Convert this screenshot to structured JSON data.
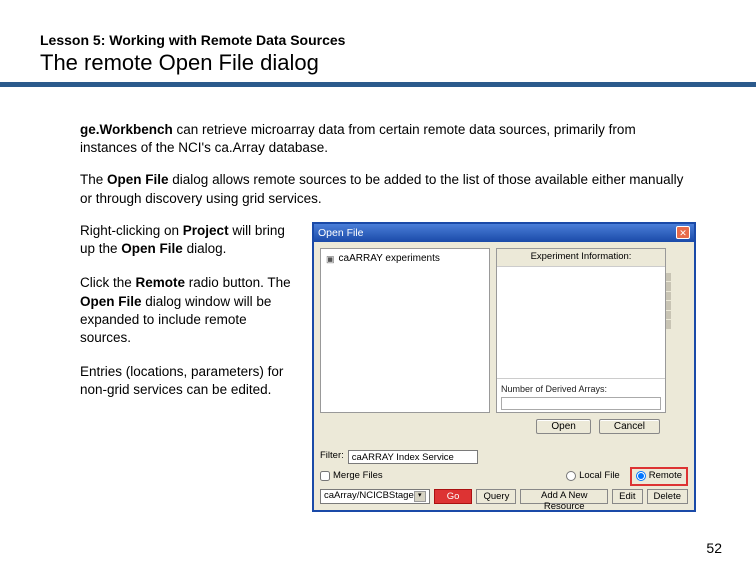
{
  "lesson_label": "Lesson 5: Working with Remote Data Sources",
  "slide_title": "The remote Open File dialog",
  "intro": {
    "brand": "ge.Workbench",
    "p1_rest": " can retrieve microarray data from certain remote data sources, primarily from instances of the NCI's ca.Array database.",
    "p2_a": "The ",
    "p2_bold": "Open File",
    "p2_b": " dialog allows remote sources to be added to the list of those available either manually or through discovery using grid services."
  },
  "left_text": {
    "p1_a": "Right-clicking on ",
    "p1_bold": "Project",
    "p1_b": " will bring up the ",
    "p1_bold2": "Open File",
    "p1_c": " dialog.",
    "p2_a": " Click the ",
    "p2_bold": "Remote",
    "p2_b": " radio button. The ",
    "p2_bold2": "Open File",
    "p2_c": " dialog window will be expanded to include remote sources.",
    "p3": "Entries (locations, parameters) for non-grid services can be edited."
  },
  "dialog": {
    "title": "Open File",
    "tree_item": "caARRAY experiments",
    "right_header": "Experiment Information:",
    "section2_label": "Number of Derived Arrays:",
    "open_btn": "Open",
    "cancel_btn": "Cancel",
    "filter_label": "Filter:",
    "filter_value": "caARRAY Index Service",
    "radio_merge": "Merge Files",
    "radio_local": "Local File",
    "radio_remote": "Remote",
    "dropdown_value": "caArray/NCICBStage",
    "go_btn": "Go",
    "query_btn": "Query",
    "add_btn": "Add A New Resource",
    "edit_btn": "Edit",
    "delete_btn": "Delete"
  },
  "page_number": "52"
}
